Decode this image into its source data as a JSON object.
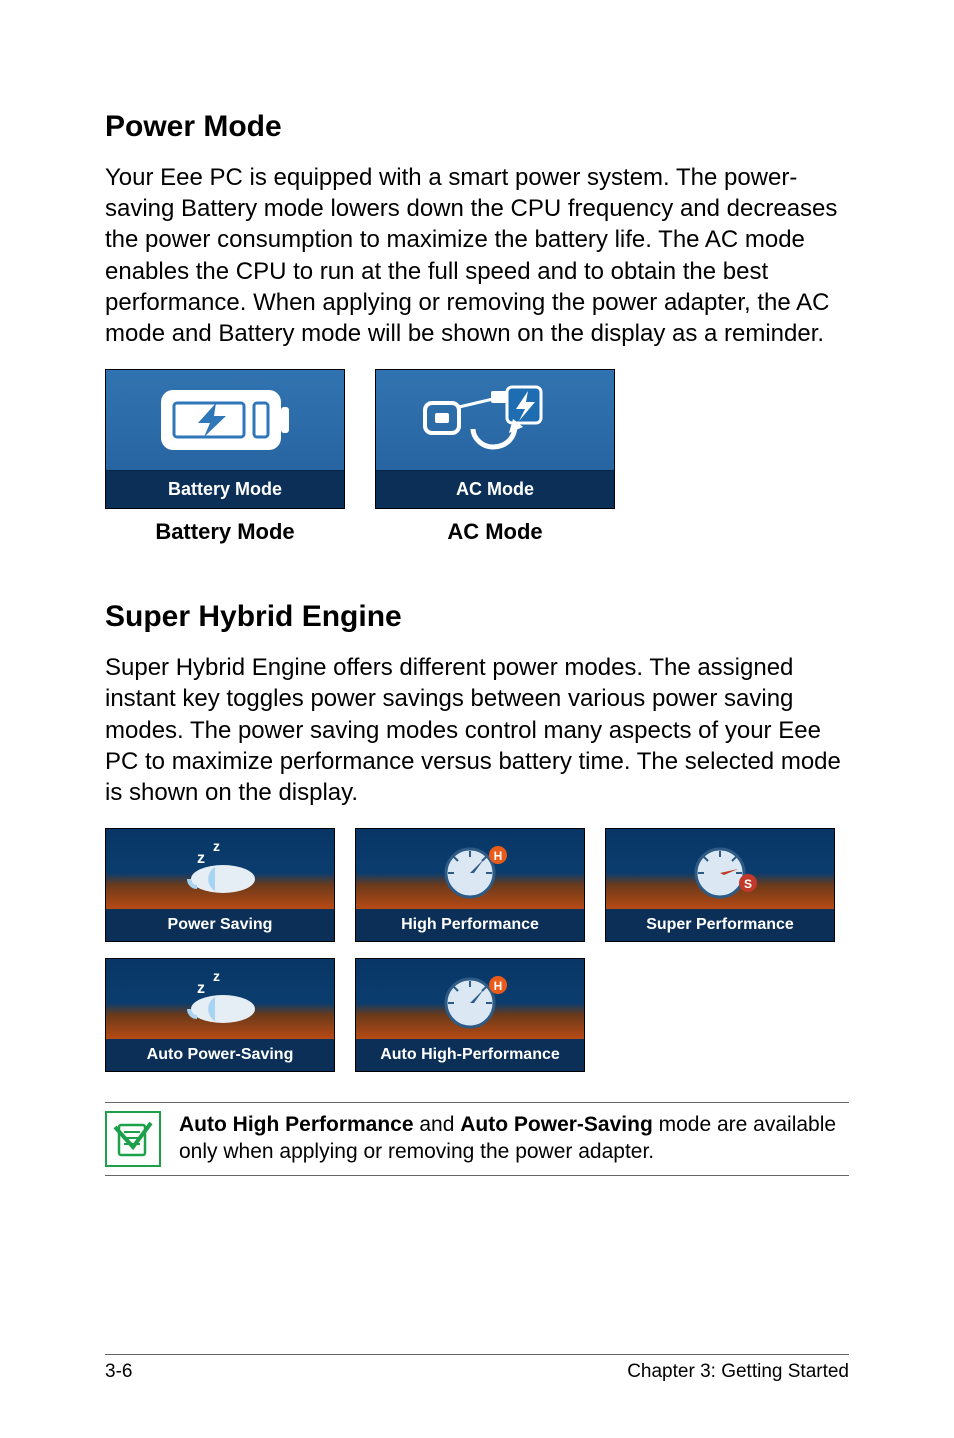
{
  "section1": {
    "heading": "Power Mode",
    "paragraph": "Your Eee PC is equipped with a smart power system. The power-saving Battery mode lowers down the CPU frequency and decreases the power consumption to maximize the battery life. The AC mode enables the CPU to run at the full speed and to obtain the best performance. When applying or removing the power adapter, the AC mode and Battery mode will be shown on the display as a reminder.",
    "tiles": [
      {
        "overlay": "Battery Mode",
        "caption": "Battery Mode"
      },
      {
        "overlay": "AC Mode",
        "caption": "AC Mode"
      }
    ]
  },
  "section2": {
    "heading": "Super Hybrid Engine",
    "paragraph": "Super Hybrid Engine offers different power modes. The assigned instant key toggles power savings between various power saving modes. The power saving modes control many aspects of your Eee PC to maximize performance versus battery time. The selected mode is shown on the display.",
    "tiles": [
      {
        "label": "Power Saving"
      },
      {
        "label": "High Performance"
      },
      {
        "label": "Super Performance"
      },
      {
        "label": "Auto Power-Saving"
      },
      {
        "label": "Auto High-Performance"
      }
    ]
  },
  "note": {
    "bold1": "Auto High Performance",
    "mid": " and ",
    "bold2": "Auto Power-Saving",
    "tail": " mode are available only when applying or removing the power adapter."
  },
  "footer": {
    "page": "3-6",
    "chapter": "Chapter 3: Getting Started"
  }
}
